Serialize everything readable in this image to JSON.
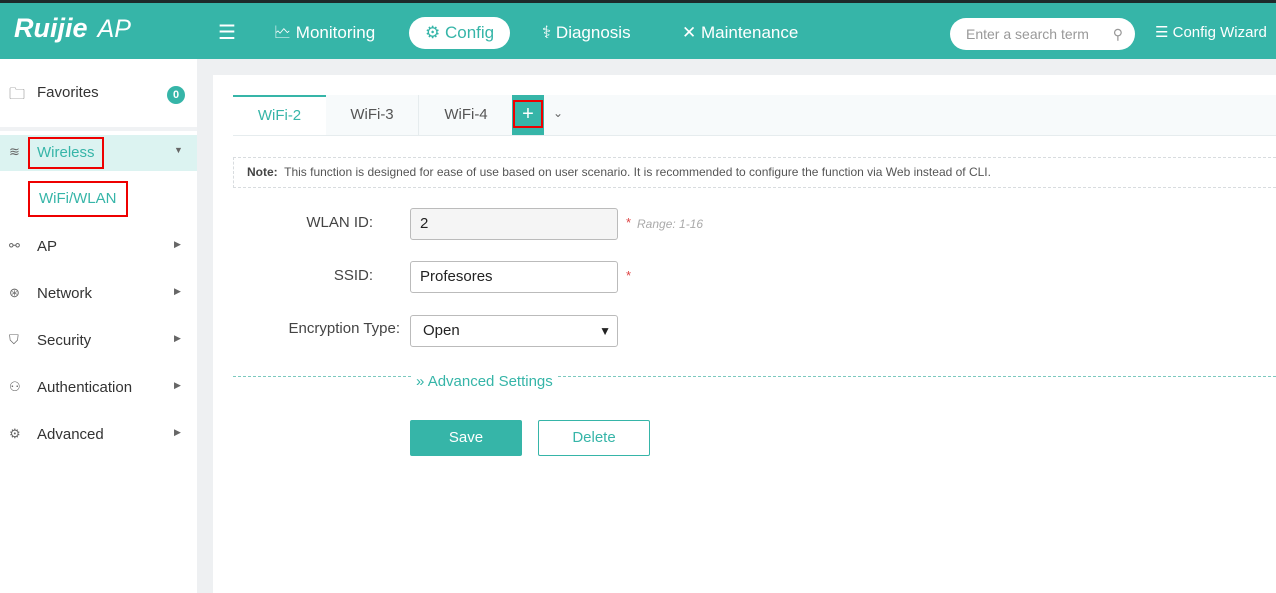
{
  "header": {
    "logo": "Ruijie",
    "product": "AP",
    "nav": [
      {
        "label": "Monitoring",
        "icon": "monitor-icon"
      },
      {
        "label": "Config",
        "icon": "gear-icon"
      },
      {
        "label": "Diagnosis",
        "icon": "stethoscope-icon"
      },
      {
        "label": "Maintenance",
        "icon": "tools-icon"
      }
    ],
    "active_nav": "Config",
    "search_placeholder": "Enter a search term",
    "config_wizard": "Config Wizard"
  },
  "sidebar": {
    "favorites": {
      "label": "Favorites",
      "count": "0"
    },
    "items": [
      {
        "label": "Wireless",
        "expanded": true
      },
      {
        "label": "WiFi/WLAN"
      },
      {
        "label": "AP"
      },
      {
        "label": "Network"
      },
      {
        "label": "Security"
      },
      {
        "label": "Authentication"
      },
      {
        "label": "Advanced"
      }
    ]
  },
  "tabs": [
    {
      "label": "WiFi-2",
      "active": true
    },
    {
      "label": "WiFi-3"
    },
    {
      "label": "WiFi-4"
    }
  ],
  "add_tab": "+",
  "note": {
    "prefix": "Note:",
    "text": "This function is designed for ease of use based on user scenario. It is recommended to configure the function via Web instead of CLI."
  },
  "form": {
    "wlan_id": {
      "label": "WLAN ID:",
      "value": "2",
      "hint": "Range: 1-16"
    },
    "ssid": {
      "label": "SSID:",
      "value": "Profesores"
    },
    "encryption": {
      "label": "Encryption Type:",
      "value": "Open"
    },
    "required_mark": "*",
    "advanced": "Advanced Settings"
  },
  "buttons": {
    "save": "Save",
    "delete": "Delete"
  },
  "colors": {
    "accent": "#36b5a8",
    "highlight": "#e00000"
  }
}
